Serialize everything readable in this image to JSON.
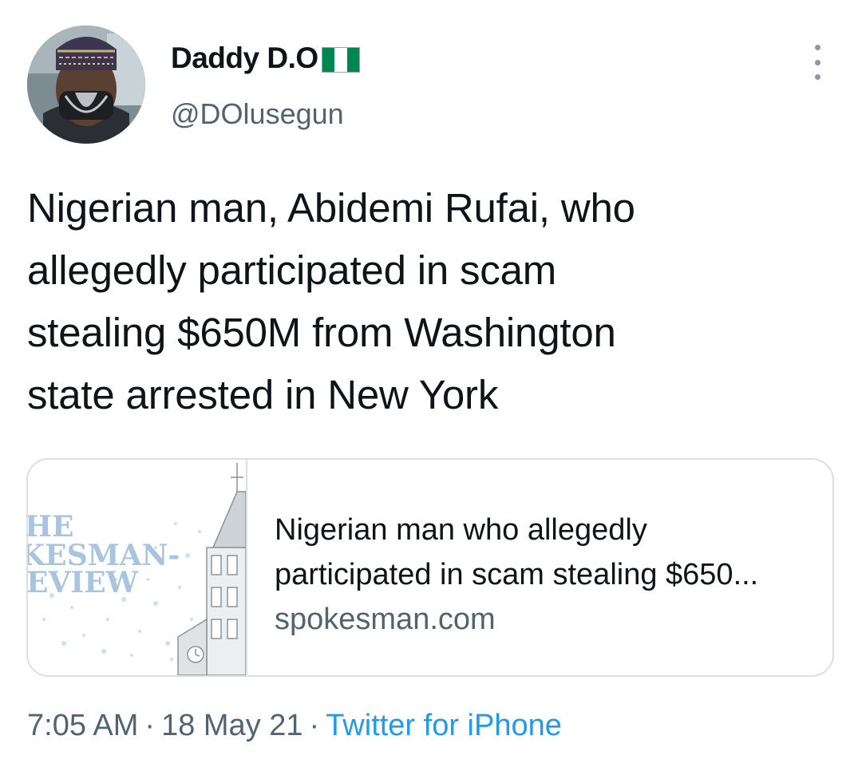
{
  "author": {
    "display_name": "Daddy D.O",
    "handle": "@DOlusegun",
    "flag_icon": "nigeria-flag-icon",
    "avatar_icon": "profile-photo-avatar"
  },
  "tweet": {
    "lines": [
      "Nigerian man, Abidemi Rufai, who",
      "allegedly participated in scam",
      "stealing $650M from Washington",
      "state arrested in New York"
    ]
  },
  "link_card": {
    "title_lines": [
      "Nigerian man who allegedly",
      "participated in scam stealing $650..."
    ],
    "domain": "spokesman.com",
    "thumbnail_text": [
      "HE",
      "KESMAN-",
      "EVIEW"
    ]
  },
  "meta": {
    "time": "7:05 AM",
    "separator": "·",
    "date": "18 May 21",
    "source": "Twitter for iPhone"
  },
  "colors": {
    "text_primary": "#0f1419",
    "text_secondary": "#536471",
    "link": "#1d9bf0",
    "border": "#d9dfe3",
    "flag_green": "#008751"
  }
}
